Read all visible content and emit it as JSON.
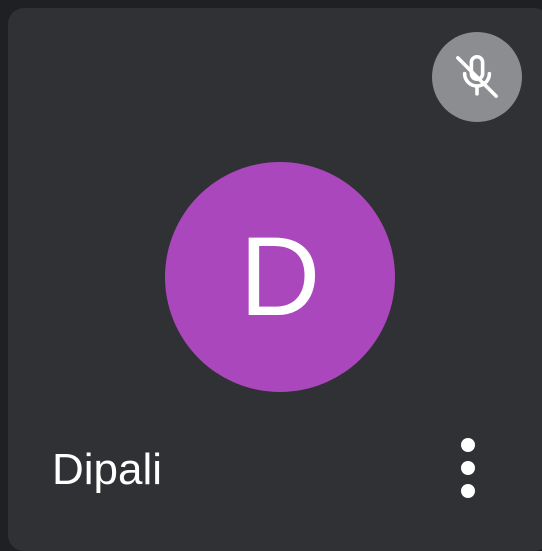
{
  "participant": {
    "name": "Dipali",
    "initial": "D",
    "avatar_color": "#ab47bc",
    "muted": true
  },
  "icons": {
    "mute_indicator": "mic-off-icon",
    "more_options": "more-vert-icon"
  },
  "colors": {
    "tile_background": "#303134",
    "mute_badge": "#8b8d90",
    "text": "#ffffff"
  }
}
